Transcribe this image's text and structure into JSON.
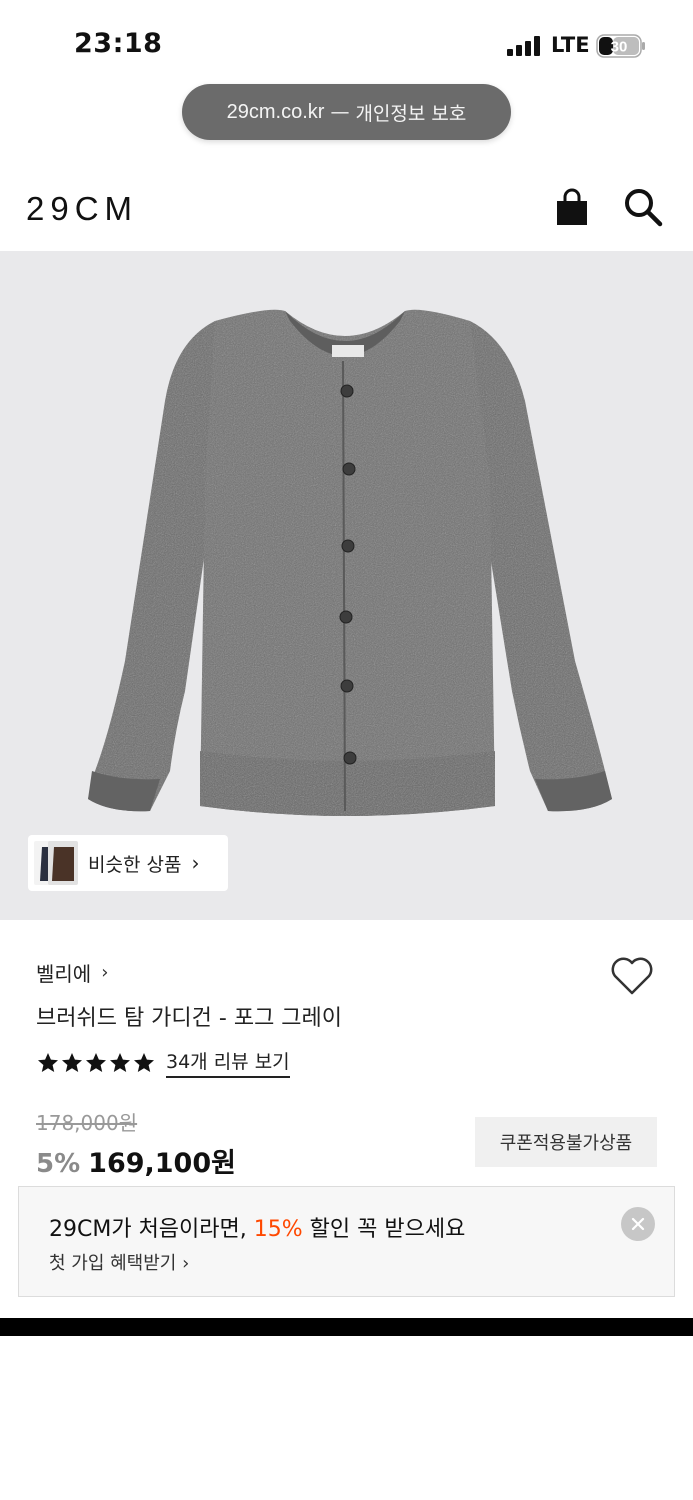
{
  "status_bar": {
    "time": "23:18",
    "network": "LTE",
    "battery": "30"
  },
  "browser": {
    "host": "29cm.co.kr",
    "separator": "—",
    "privacy_label": "개인정보 보호"
  },
  "header": {
    "logo": "29CM",
    "icons": [
      "shopping-bag-icon",
      "search-icon"
    ]
  },
  "product": {
    "similar_label": "비슷한 상품",
    "brand": "벨리에",
    "name": "브러쉬드 탐 가디건 - 포그 그레이",
    "rating_stars": 5,
    "review_link": "34개 리뷰 보기",
    "original_price": "178,000원",
    "discount": "5%",
    "sale_price": "169,100원",
    "coupon_badge": "쿠폰적용불가상품"
  },
  "promo": {
    "title_before": "29CM가 처음이라면, ",
    "title_accent": "15%",
    "title_after": " 할인 꼭 받으세요",
    "subtitle": "첫 가입 혜택받기",
    "accent_color": "#ff4800"
  },
  "colors": {
    "image_background": "#e9e9eb",
    "sweater": "#6d6d6d"
  }
}
